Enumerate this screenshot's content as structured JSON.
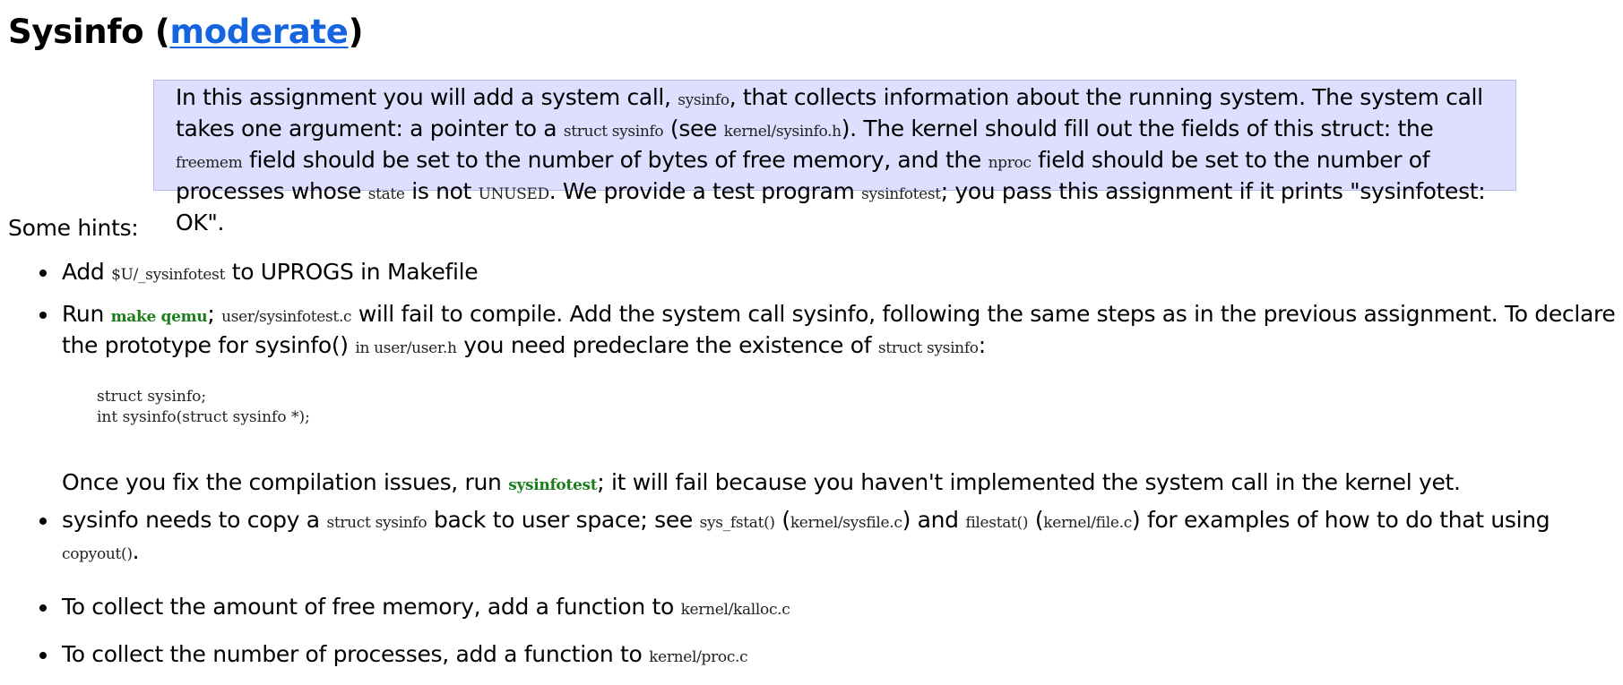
{
  "heading": {
    "title": "Sysinfo",
    "difficulty": "moderate"
  },
  "prompt": {
    "p1": "In this assignment you will add a system call,",
    "c1": "sysinfo",
    "p2": ", that collects information about the running system. The system call takes one argument: a pointer to a",
    "c2": "struct sysinfo",
    "p3": "(see",
    "c3": "kernel/sysinfo.h",
    "p4": "). The kernel should fill out the fields of this struct: the",
    "c4": "freemem",
    "p5": "field should be set to the number of bytes of free memory, and the",
    "c5": "nproc",
    "p6": "field should be set to the number of processes whose",
    "c6": "state",
    "p7": "is not",
    "c7": "UNUSED",
    "p8": ". We provide a test program",
    "c8": "sysinfotest",
    "p9": "; you pass this assignment if it prints \"sysinfotest: OK\"."
  },
  "hints_label": "Some hints:",
  "hint1": {
    "t1": "Add",
    "c1": "$U/_sysinfotest",
    "t2": "to UPROGS in Makefile"
  },
  "hint2": {
    "t1": "Run",
    "k1": "make qemu",
    "t2": ";",
    "c1": "user/sysinfotest.c",
    "t3": "will fail to compile. Add the system call sysinfo, following the same steps as in the previous assignment. To declare the prototype for sysinfo()",
    "c2": "in user/user.h",
    "t4": "you need predeclare the existence of",
    "c3": "struct sysinfo",
    "t5": ":",
    "code": "struct sysinfo;\nint sysinfo(struct sysinfo *);",
    "t6": "Once you fix the compilation issues, run",
    "k2": "sysinfotest",
    "t7": "; it will fail because you haven't implemented the system call in the kernel yet."
  },
  "hint3": {
    "t1": "sysinfo needs to copy a",
    "c1": "struct sysinfo",
    "t2": "back to user space; see",
    "c2": "sys_fstat()",
    "t3": "(",
    "c3": "kernel/sysfile.c",
    "t4": ") and",
    "c4": "filestat()",
    "t5": "(",
    "c5": "kernel/file.c",
    "t6": ") for examples of how to do that using",
    "c6": "copyout()",
    "t7": "."
  },
  "hint4": {
    "t1": "To collect the amount of free memory, add a function to",
    "c1": "kernel/kalloc.c"
  },
  "hint5": {
    "t1": "To collect the number of processes, add a function to",
    "c1": "kernel/proc.c"
  },
  "colors": {
    "link": "#1565e0",
    "prompt_bg": "#dedeff",
    "kbd": "#1a7f1a"
  }
}
